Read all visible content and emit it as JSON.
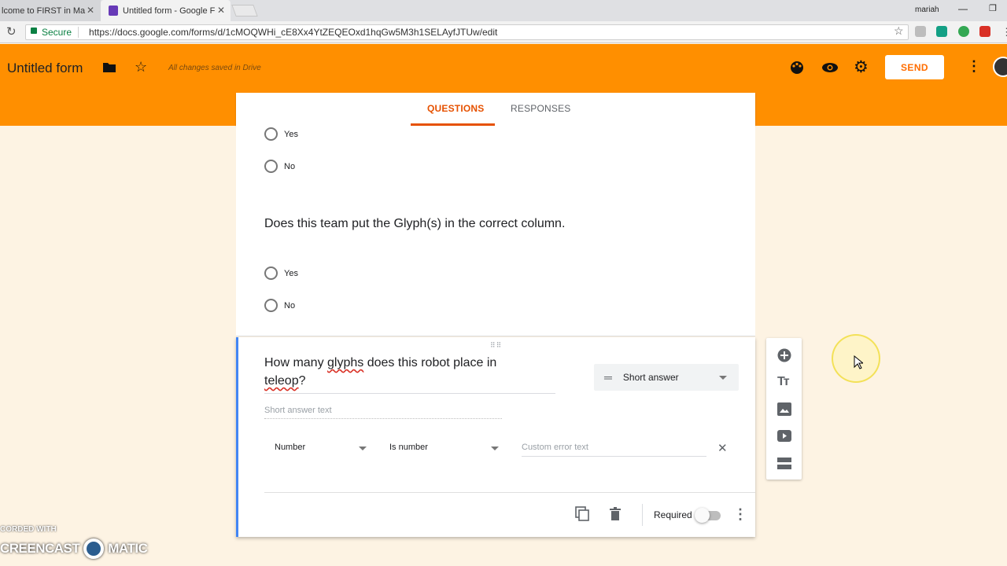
{
  "browser": {
    "tabs": [
      {
        "label": "lcome to FIRST in Ma"
      },
      {
        "label": "Untitled form - Google F"
      }
    ],
    "user_name": "mariah",
    "secure_label": "Secure",
    "url": "https://docs.google.com/forms/d/1cMOQWHi_cE8Xx4YtZEQEOxd1hqGw5M3h1SELAyfJTUw/edit"
  },
  "header": {
    "title": "Untitled form",
    "saved_status": "All changes saved in Drive",
    "send_label": "SEND",
    "accent_color": "#ff8f00"
  },
  "form_tabs": [
    {
      "label": "QUESTIONS",
      "active": true
    },
    {
      "label": "RESPONSES",
      "active": false
    }
  ],
  "questions": [
    {
      "options": [
        "Yes",
        "No"
      ]
    },
    {
      "title": "Does this team put the Glyph(s) in the correct column.",
      "options": [
        "Yes",
        "No"
      ]
    }
  ],
  "active_question": {
    "title_part1": "How many ",
    "title_misspelled": "glyphs",
    "title_part2": " does this robot place in",
    "title_line2": "teleop",
    "title_end": "?",
    "type": "Short answer",
    "answer_placeholder": "Short answer text",
    "validation": {
      "category": "Number",
      "rule": "Is number",
      "error_placeholder": "Custom error text"
    },
    "required_label": "Required",
    "required": false
  },
  "sidebar_tools": [
    "add-question-icon",
    "add-title-icon",
    "add-image-icon",
    "add-video-icon",
    "add-section-icon"
  ],
  "watermark": {
    "line1": "CORDED WITH",
    "line2a": "CREENCAST",
    "line2b": "MATIC"
  }
}
